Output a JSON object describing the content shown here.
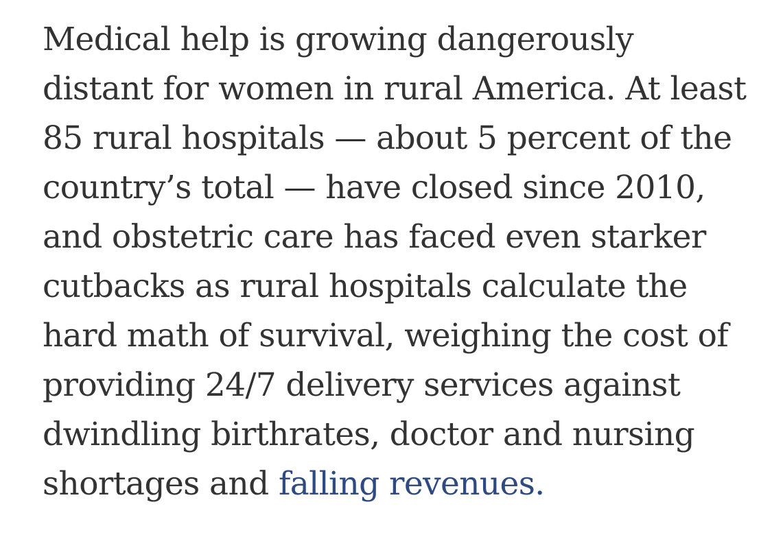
{
  "article": {
    "lines": [
      "Medical help is growing dangerously",
      "distant for women in rural America. At least",
      "85 rural hospitals — about 5 percent of the",
      "country’s total — have closed since 2010,",
      "and obstetric care has faced even starker",
      "cutbacks as rural hospitals calculate the",
      "hard math of survival, weighing the cost of",
      "providing 24/7 delivery services against",
      "dwindling birthrates, doctor and nursing"
    ],
    "last_line_prefix": "shortages and ",
    "highlighted_text": "falling revenues.",
    "highlight_color": "#8dbbf5"
  }
}
